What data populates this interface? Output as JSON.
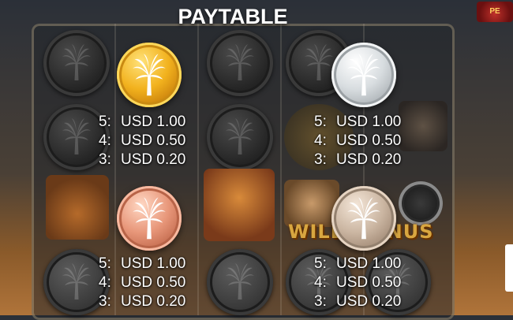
{
  "title": "PAYTABLE",
  "corner_logo_text": "PE",
  "wild_bonus_text": "WILD BONUS",
  "colors": {
    "gold": "#f2b21e",
    "silver": "#d8dde0",
    "bronze": "#e8977a",
    "pearl": "#cbb6a2",
    "text": "#ffffff"
  },
  "symbols": [
    {
      "icon": "gold-palm-coin-icon",
      "pays": [
        {
          "count": "5:",
          "amount": "USD 1.00"
        },
        {
          "count": "4:",
          "amount": "USD 0.50"
        },
        {
          "count": "3:",
          "amount": "USD 0.20"
        }
      ]
    },
    {
      "icon": "silver-palm-coin-icon",
      "pays": [
        {
          "count": "5:",
          "amount": "USD 1.00"
        },
        {
          "count": "4:",
          "amount": "USD 0.50"
        },
        {
          "count": "3:",
          "amount": "USD 0.20"
        }
      ]
    },
    {
      "icon": "bronze-palm-coin-icon",
      "pays": [
        {
          "count": "5:",
          "amount": "USD 1.00"
        },
        {
          "count": "4:",
          "amount": "USD 0.50"
        },
        {
          "count": "3:",
          "amount": "USD 0.20"
        }
      ]
    },
    {
      "icon": "pearl-palm-coin-icon",
      "pays": [
        {
          "count": "5:",
          "amount": "USD 1.00"
        },
        {
          "count": "4:",
          "amount": "USD 0.50"
        },
        {
          "count": "3:",
          "amount": "USD 0.20"
        }
      ]
    }
  ]
}
